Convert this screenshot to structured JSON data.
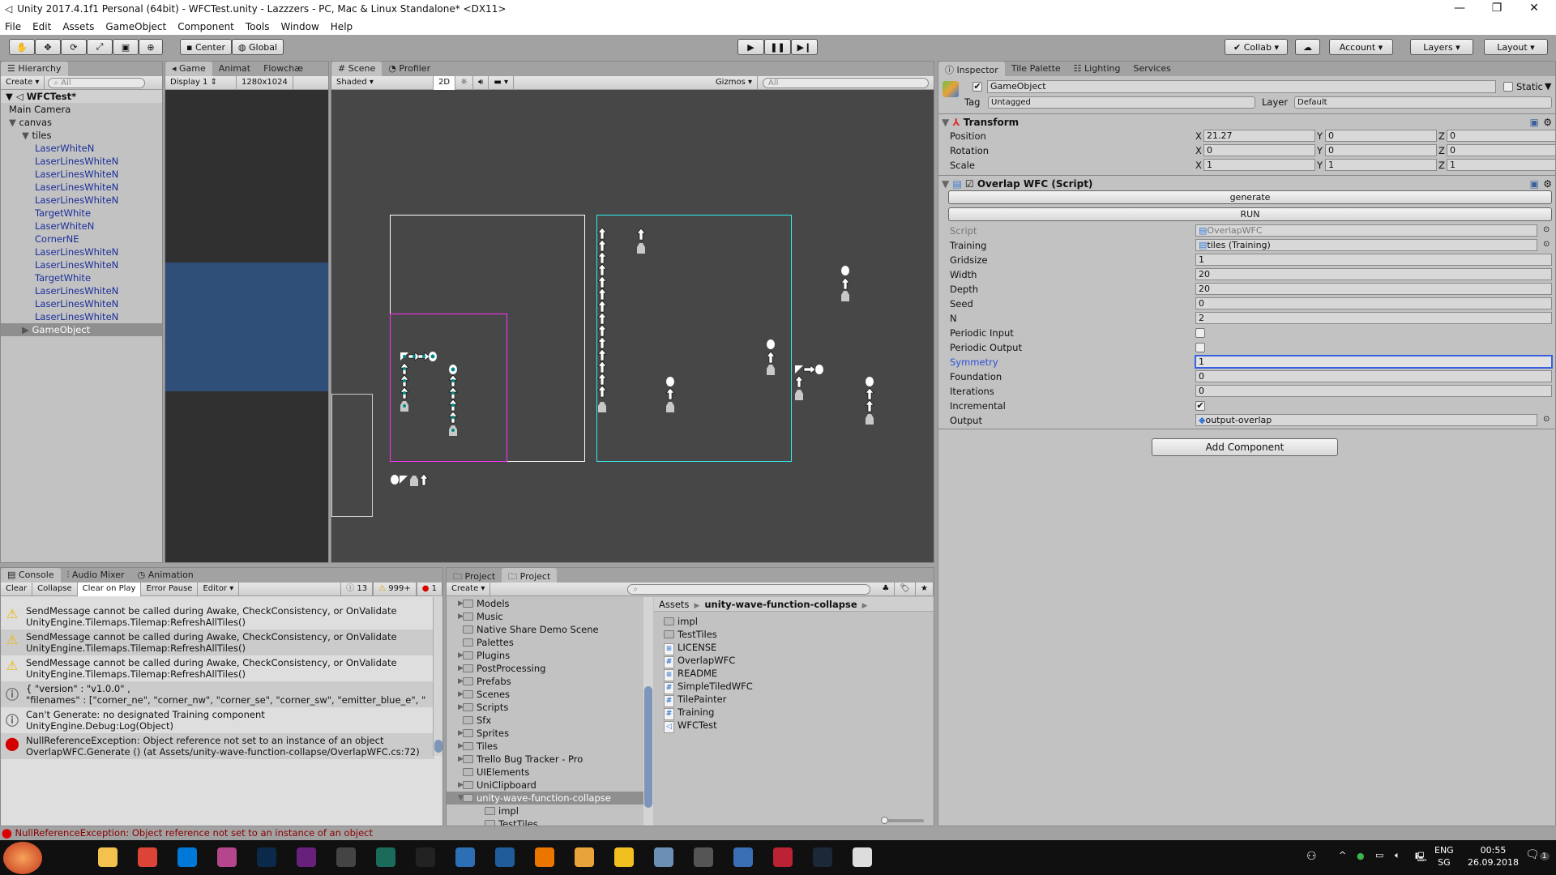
{
  "window": {
    "title": "Unity 2017.4.1f1 Personal (64bit) - WFCTest.unity - Lazzzers - PC, Mac & Linux Standalone* <DX11>"
  },
  "menu": [
    "File",
    "Edit",
    "Assets",
    "GameObject",
    "Component",
    "Tools",
    "Window",
    "Help"
  ],
  "toolbar": {
    "center": "Center",
    "global": "Global",
    "collab": "Collab",
    "account": "Account",
    "layers": "Layers",
    "layout": "Layout"
  },
  "hierarchy": {
    "tab": "Hierarchy",
    "create": "Create",
    "search_placeholder": "All",
    "scene": "WFCTest*",
    "items": [
      {
        "label": "Main Camera",
        "depth": 1,
        "prefab": false
      },
      {
        "label": "canvas",
        "depth": 1,
        "prefab": false,
        "expanded": true
      },
      {
        "label": "tiles",
        "depth": 2,
        "prefab": false,
        "expanded": true
      },
      {
        "label": "LaserWhiteN",
        "depth": 3,
        "prefab": true
      },
      {
        "label": "LaserLinesWhiteN",
        "depth": 3,
        "prefab": true
      },
      {
        "label": "LaserLinesWhiteN",
        "depth": 3,
        "prefab": true
      },
      {
        "label": "LaserLinesWhiteN",
        "depth": 3,
        "prefab": true
      },
      {
        "label": "LaserLinesWhiteN",
        "depth": 3,
        "prefab": true
      },
      {
        "label": "TargetWhite",
        "depth": 3,
        "prefab": true
      },
      {
        "label": "LaserWhiteN",
        "depth": 3,
        "prefab": true
      },
      {
        "label": "CornerNE",
        "depth": 3,
        "prefab": true
      },
      {
        "label": "LaserLinesWhiteN",
        "depth": 3,
        "prefab": true
      },
      {
        "label": "LaserLinesWhiteN",
        "depth": 3,
        "prefab": true
      },
      {
        "label": "TargetWhite",
        "depth": 3,
        "prefab": true
      },
      {
        "label": "LaserLinesWhiteN",
        "depth": 3,
        "prefab": true
      },
      {
        "label": "LaserLinesWhiteN",
        "depth": 3,
        "prefab": true
      },
      {
        "label": "LaserLinesWhiteN",
        "depth": 3,
        "prefab": true
      },
      {
        "label": "GameObject",
        "depth": 2,
        "prefab": false,
        "selected": true
      }
    ]
  },
  "game": {
    "tabs": [
      "Game",
      "Animat",
      "Flowchæ"
    ],
    "display": "Display 1",
    "resolution": "1280x1024"
  },
  "scene": {
    "tabs": [
      "Scene",
      "Profiler"
    ],
    "shading": "Shaded",
    "mode2d": "2D",
    "gizmos": "Gizmos",
    "search_placeholder": "All",
    "colors": {
      "background": "#474747",
      "input_frame": "#ff30ff",
      "output_frame": "#30f0f0",
      "tile": "#ffffff",
      "marker": "#008b8b"
    }
  },
  "inspector": {
    "tabs": [
      "Inspector",
      "Tile Palette",
      "Lighting",
      "Services"
    ],
    "object_name": "GameObject",
    "active": true,
    "static_label": "Static",
    "static": false,
    "tag_label": "Tag",
    "tag": "Untagged",
    "layer_label": "Layer",
    "layer": "Default",
    "transform": {
      "title": "Transform",
      "rows": [
        {
          "label": "Position",
          "x": "21.27",
          "y": "0",
          "z": "0"
        },
        {
          "label": "Rotation",
          "x": "0",
          "y": "0",
          "z": "0"
        },
        {
          "label": "Scale",
          "x": "1",
          "y": "1",
          "z": "1"
        }
      ]
    },
    "script": {
      "title": "Overlap WFC (Script)",
      "enabled": true,
      "buttons": [
        "generate",
        "RUN"
      ],
      "fields": [
        {
          "label": "Script",
          "value": "OverlapWFC",
          "type": "object",
          "disabled": true
        },
        {
          "label": "Training",
          "value": "tiles (Training)",
          "type": "object"
        },
        {
          "label": "Gridsize",
          "value": "1",
          "type": "text"
        },
        {
          "label": "Width",
          "value": "20",
          "type": "text"
        },
        {
          "label": "Depth",
          "value": "20",
          "type": "text"
        },
        {
          "label": "Seed",
          "value": "0",
          "type": "text"
        },
        {
          "label": "N",
          "value": "2",
          "type": "text"
        },
        {
          "label": "Periodic Input",
          "checked": false,
          "type": "check"
        },
        {
          "label": "Periodic Output",
          "checked": false,
          "type": "check"
        },
        {
          "label": "Symmetry",
          "value": "1",
          "type": "text",
          "focused": true
        },
        {
          "label": "Foundation",
          "value": "0",
          "type": "text"
        },
        {
          "label": "Iterations",
          "value": "0",
          "type": "text"
        },
        {
          "label": "Incremental",
          "checked": true,
          "type": "check"
        },
        {
          "label": "Output",
          "value": "output-overlap",
          "type": "object"
        }
      ]
    },
    "add_component": "Add Component"
  },
  "console": {
    "tabs": [
      "Console",
      "Audio Mixer",
      "Animation"
    ],
    "buttons": [
      "Clear",
      "Collapse",
      "Clear on Play",
      "Error Pause",
      "Editor"
    ],
    "counts": {
      "info": "13",
      "warn": "999+",
      "error": "1"
    },
    "entries": [
      {
        "type": "warn",
        "line1": "SendMessage cannot be called during Awake, CheckConsistency, or OnValidate",
        "line2": "UnityEngine.Tilemaps.Tilemap:RefreshAllTiles()"
      },
      {
        "type": "warn",
        "line1": "SendMessage cannot be called during Awake, CheckConsistency, or OnValidate",
        "line2": "UnityEngine.Tilemaps.Tilemap:RefreshAllTiles()"
      },
      {
        "type": "warn",
        "line1": "SendMessage cannot be called during Awake, CheckConsistency, or OnValidate",
        "line2": "UnityEngine.Tilemaps.Tilemap:RefreshAllTiles()"
      },
      {
        "type": "info",
        "line1": "{ \"version\" : \"v1.0.0\" ,",
        "line2": " \"filenames\" : [\"corner_ne\", \"corner_nw\", \"corner_se\", \"corner_sw\", \"emitter_blue_e\", \""
      },
      {
        "type": "info",
        "line1": "Can't Generate: no designated Training component",
        "line2": "UnityEngine.Debug:Log(Object)"
      },
      {
        "type": "error",
        "line1": "NullReferenceException: Object reference not set to an instance of an object",
        "line2": "OverlapWFC.Generate () (at Assets/unity-wave-function-collapse/OverlapWFC.cs:72)"
      }
    ]
  },
  "project": {
    "tabs": [
      "Project",
      "Project"
    ],
    "create": "Create",
    "tree": [
      {
        "label": "Models",
        "arrow": true,
        "depth": 0
      },
      {
        "label": "Music",
        "arrow": true,
        "depth": 0
      },
      {
        "label": "Native Share Demo Scene",
        "arrow": false,
        "depth": 0
      },
      {
        "label": "Palettes",
        "arrow": false,
        "depth": 0
      },
      {
        "label": "Plugins",
        "arrow": true,
        "depth": 0
      },
      {
        "label": "PostProcessing",
        "arrow": true,
        "depth": 0
      },
      {
        "label": "Prefabs",
        "arrow": true,
        "depth": 0
      },
      {
        "label": "Scenes",
        "arrow": true,
        "depth": 0
      },
      {
        "label": "Scripts",
        "arrow": true,
        "depth": 0
      },
      {
        "label": "Sfx",
        "arrow": false,
        "depth": 0
      },
      {
        "label": "Sprites",
        "arrow": true,
        "depth": 0
      },
      {
        "label": "Tiles",
        "arrow": true,
        "depth": 0
      },
      {
        "label": "Trello Bug Tracker - Pro",
        "arrow": true,
        "depth": 0
      },
      {
        "label": "UIElements",
        "arrow": false,
        "depth": 0
      },
      {
        "label": "UniClipboard",
        "arrow": true,
        "depth": 0
      },
      {
        "label": "unity-wave-function-collapse",
        "arrow": true,
        "depth": 0,
        "selected": true
      },
      {
        "label": "impl",
        "arrow": false,
        "depth": 1
      },
      {
        "label": "TestTiles",
        "arrow": false,
        "depth": 1
      }
    ],
    "breadcrumb": [
      "Assets",
      "unity-wave-function-collapse"
    ],
    "files": [
      {
        "label": "impl",
        "icon": "folder"
      },
      {
        "label": "TestTiles",
        "icon": "folder"
      },
      {
        "label": "LICENSE",
        "icon": "text"
      },
      {
        "label": "OverlapWFC",
        "icon": "script"
      },
      {
        "label": "README",
        "icon": "text"
      },
      {
        "label": "SimpleTiledWFC",
        "icon": "script"
      },
      {
        "label": "TilePainter",
        "icon": "script"
      },
      {
        "label": "Training",
        "icon": "script"
      },
      {
        "label": "WFCTest",
        "icon": "unity"
      }
    ]
  },
  "statusbar": {
    "message": "NullReferenceException: Object reference not set to an instance of an object"
  },
  "taskbar": {
    "lang1": "ENG",
    "lang2": "SG",
    "time": "00:55",
    "date": "26.09.2018",
    "notifications": "1"
  }
}
